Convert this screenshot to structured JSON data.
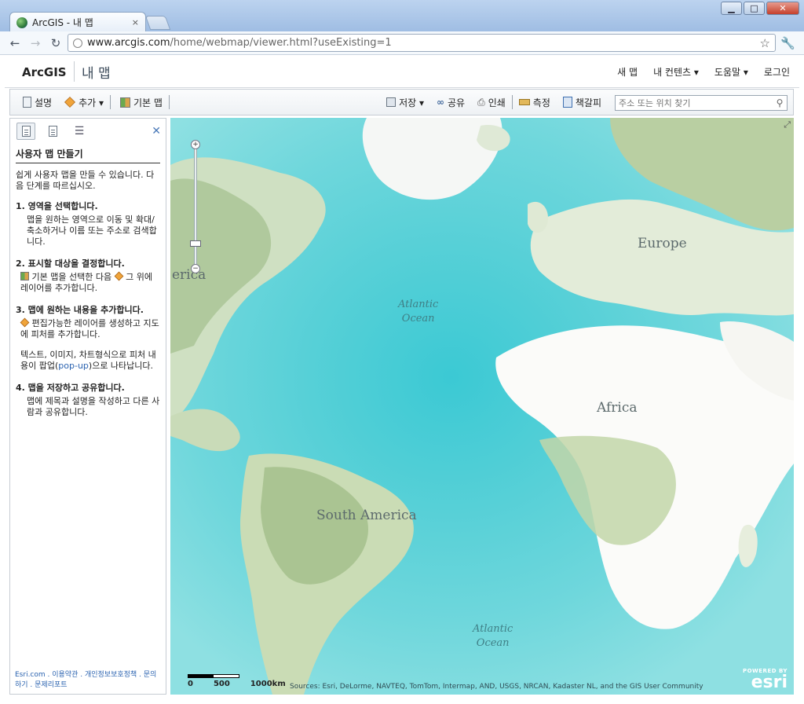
{
  "browser": {
    "tab_title": "ArcGIS - 내 맵",
    "tab_close": "×",
    "url_host": "www.arcgis.com",
    "url_path": "/home/webmap/viewer.html?useExisting=1",
    "window_buttons": [
      "▁",
      "□",
      "✕"
    ]
  },
  "header": {
    "logo": "ArcGIS",
    "section": "내 맵",
    "nav": [
      "새 맵",
      "내 컨텐츠 ▾",
      "도움말 ▾",
      "로그인"
    ]
  },
  "toolbar": {
    "details": "설명",
    "add": "추가 ▾",
    "basemap": "기본 맵",
    "save": "저장 ▾",
    "share": "공유",
    "print": "인쇄",
    "measure": "측정",
    "bookmarks": "책갈피",
    "search_placeholder": "주소 또는 위치 찾기",
    "colors": {
      "save": "#6a7683",
      "share": "#4a6fa0",
      "measure": "#c08a2a",
      "bookmark": "#3e6fb0"
    }
  },
  "panel": {
    "close": "✕",
    "title": "사용자 맵 만들기",
    "intro": "쉽게 사용자 맵을 만들 수 있습니다. 다음 단계를 따르십시오.",
    "steps": [
      {
        "heading": "1. 영역을 선택합니다.",
        "text": "맵을 원하는 영역으로 이동 및 확대/축소하거나 이름 또는 주소로 검색합니다."
      },
      {
        "heading": "2. 표시할 대상을 결정합니다.",
        "text_a": "기본 맵을 선택한 다음",
        "text_b": "그 위에 레이어를 추가합니다."
      },
      {
        "heading": "3. 맵에 원하는 내용을 추가합니다.",
        "text": "편집가능한 레이어를 생성하고 지도에 피처를 추가합니다.",
        "text2_a": "텍스트, 이미지, 차트형식으로 피처 내용이 팝업(",
        "text2_link": "pop-up",
        "text2_b": ")으로 나타납니다."
      },
      {
        "heading": "4. 맵을 저장하고 공유합니다.",
        "text": "맵에 제목과 설명을 작성하고 다른 사람과 공유합니다."
      }
    ],
    "footer": "Esri.com . 이용약관 . 개인정보보호정책 . 문의하기 . 문제리포트"
  },
  "map": {
    "labels": {
      "europe": "Europe",
      "africa": "Africa",
      "south_america": "South America",
      "america_partial": "erica",
      "atlantic_north_1": "Atlantic",
      "atlantic_north_2": "Ocean",
      "atlantic_south_1": "Atlantic",
      "atlantic_south_2": "Ocean"
    },
    "zoom_plus": "+",
    "zoom_minus": "−",
    "scale_labels": [
      "0",
      "500",
      "1000km"
    ],
    "sources": "Sources: Esri, DeLorme, NAVTEQ, TomTom, Intermap, AND, USGS, NRCAN, Kadaster NL, and the GIS User Community",
    "powered_by": "POWERED BY",
    "esri_logo": "esri"
  }
}
